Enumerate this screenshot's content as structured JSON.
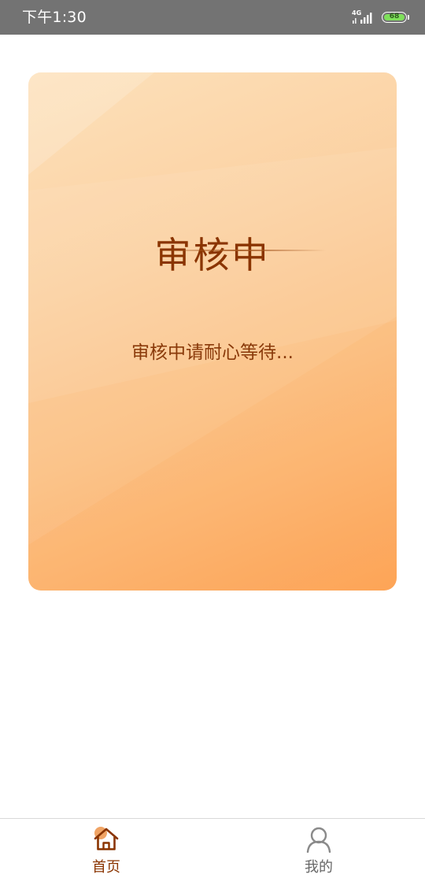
{
  "status_bar": {
    "time": "下午1:30",
    "network": "4G",
    "battery_level": "68"
  },
  "card": {
    "title": "审核中",
    "message": "审核中请耐心等待..."
  },
  "tab_bar": {
    "tabs": [
      {
        "label": "首页",
        "icon": "home-icon",
        "active": true
      },
      {
        "label": "我的",
        "icon": "user-icon",
        "active": false
      }
    ]
  },
  "colors": {
    "status_bar_bg": "#737373",
    "card_gradient_start": "#fde1bb",
    "card_gradient_end": "#fda65a",
    "title_text": "#8a3400",
    "active_tab": "#8a3400",
    "inactive_tab": "#666666"
  }
}
